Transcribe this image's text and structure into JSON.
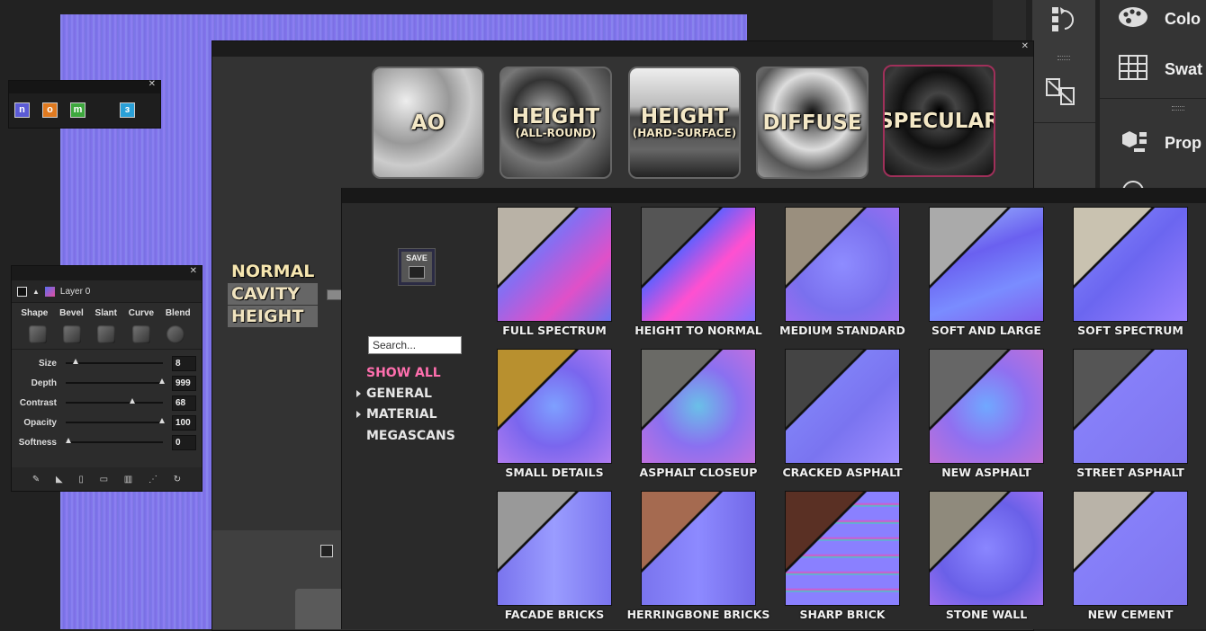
{
  "dock": {
    "panel_items": [
      {
        "icon": "palette-icon",
        "label": "Colo"
      },
      {
        "icon": "grid-icon",
        "label": "Swat"
      },
      {
        "icon": "cube-properties-icon",
        "label": "Prop"
      }
    ]
  },
  "small_tools": {
    "icons": [
      "n",
      "o",
      "m",
      "з"
    ],
    "icon_colors": [
      "#5b5bd6",
      "#e07a20",
      "#3ea83e",
      "#2aa0d8"
    ]
  },
  "bevel": {
    "layer_name": "Layer 0",
    "tabs": [
      "Shape",
      "Bevel",
      "Slant",
      "Curve",
      "Blend"
    ],
    "sliders": [
      {
        "label": "Size",
        "value": "8",
        "pos": 0.08
      },
      {
        "label": "Depth",
        "value": "999",
        "pos": 1.0
      },
      {
        "label": "Contrast",
        "value": "68",
        "pos": 0.68
      },
      {
        "label": "Opacity",
        "value": "100",
        "pos": 1.0
      },
      {
        "label": "Softness",
        "value": "0",
        "pos": 0.0
      }
    ]
  },
  "modes": {
    "top": [
      {
        "big": "AO",
        "small": ""
      },
      {
        "big": "HEIGHT",
        "small": "(ALL-ROUND)"
      },
      {
        "big": "HEIGHT",
        "small": "(HARD-SURFACE)"
      },
      {
        "big": "DIFFUSE",
        "small": ""
      },
      {
        "big": "SPECULAR",
        "small": ""
      }
    ],
    "side": [
      "NORMAL",
      "CAVITY",
      "HEIGHT"
    ]
  },
  "library": {
    "save_label": "SAVE",
    "search_placeholder": "Search...",
    "categories": [
      "SHOW ALL",
      "GENERAL",
      "MATERIAL",
      "MEGASCANS"
    ],
    "presets": [
      "FULL SPECTRUM",
      "HEIGHT TO NORMAL",
      "MEDIUM STANDARD",
      "SOFT AND LARGE",
      "SOFT SPECTRUM",
      "SMALL DETAILS",
      "ASPHALT CLOSEUP",
      "CRACKED ASPHALT",
      "NEW ASPHALT",
      "STREET ASPHALT",
      "FACADE BRICKS",
      "HERRINGBONE BRICKS",
      "SHARP BRICK",
      "STONE WALL",
      "NEW CEMENT"
    ]
  },
  "colors": {
    "accent_pink": "#ff6fae",
    "normal_blue": "#7f74ee",
    "selected_border": "#a0305a"
  }
}
